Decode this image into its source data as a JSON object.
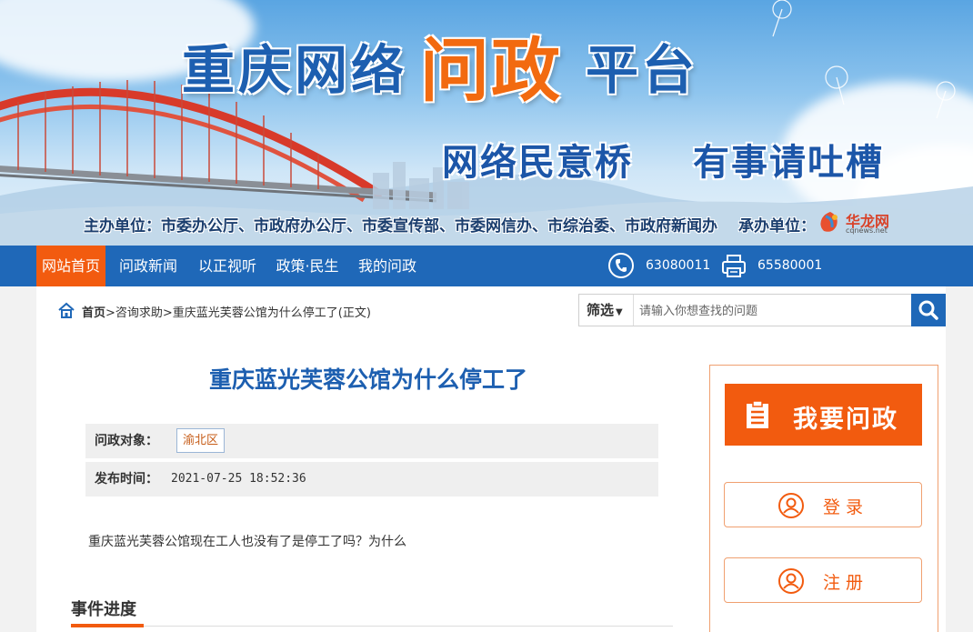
{
  "banner": {
    "title_main": "重庆网络",
    "title_accent": "问政",
    "title_tail": "平台",
    "slogan_1": "网络民意桥",
    "slogan_2": "有事请吐槽",
    "sponsor": "主办单位：市委办公厅、市政府办公厅、市委宣传部、市委网信办、市综治委、市政府新闻办",
    "co_organizer": "承办单位：",
    "logo_name": "华龙网",
    "logo_url": "cqnews.net"
  },
  "nav": {
    "items": [
      {
        "label": "网站首页",
        "active": true
      },
      {
        "label": "问政新闻",
        "active": false
      },
      {
        "label": "以正视听",
        "active": false
      },
      {
        "label": "政策·民生",
        "active": false
      },
      {
        "label": "我的问政",
        "active": false
      }
    ],
    "phone": "63080011",
    "fax": "65580001"
  },
  "breadcrumb": {
    "home": "首页",
    "path": ">咨询求助>重庆蓝光芙蓉公馆为什么停工了(正文)"
  },
  "search": {
    "filter_label": "筛选",
    "placeholder": "请输入你想查找的问题"
  },
  "article": {
    "title": "重庆蓝光芙蓉公馆为什么停工了",
    "target_label": "问政对象：",
    "target_value": "渝北区",
    "time_label": "发布时间：",
    "time_value": "2021-07-25 18:52:36",
    "content": "重庆蓝光芙蓉公馆现在工人也没有了是停工了吗？为什么",
    "progress_heading": "事件进度"
  },
  "sidebar": {
    "ask_label": "我要问政",
    "login_label": "登录",
    "register_label": "注册"
  },
  "colors": {
    "brand_blue": "#1f68b8",
    "accent_orange": "#f25b0f"
  }
}
